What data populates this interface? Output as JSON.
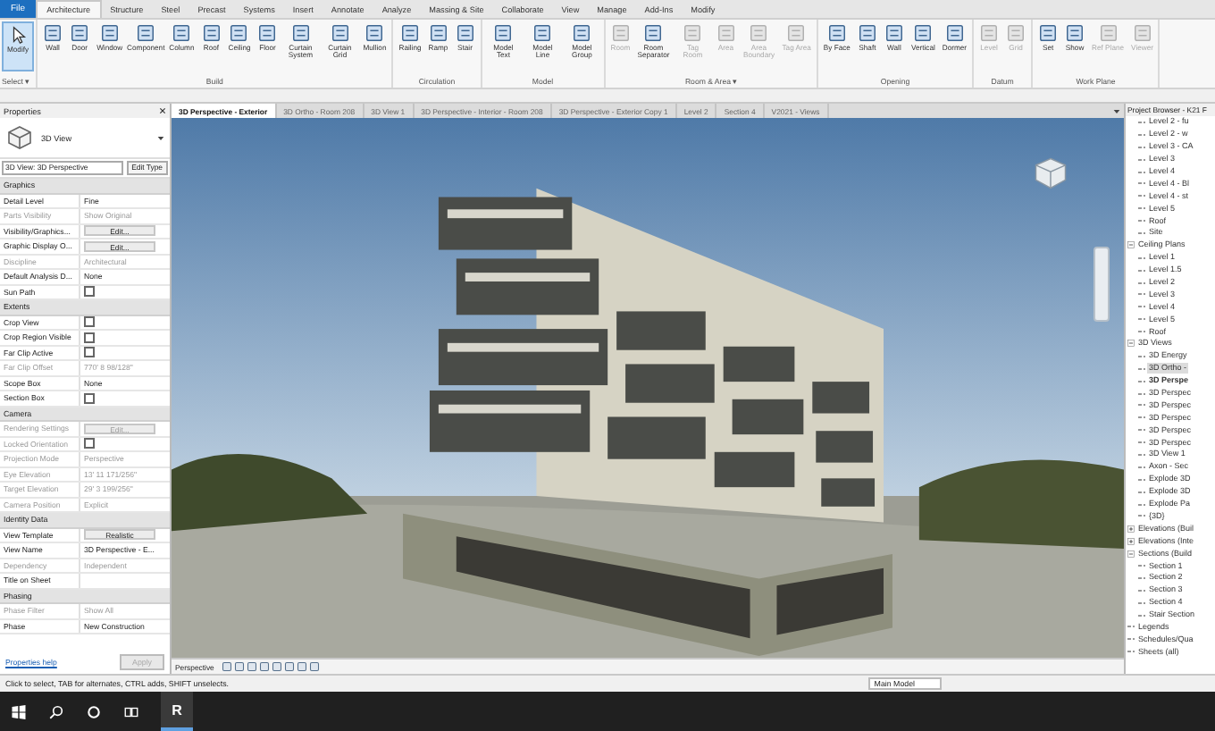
{
  "file_menu": "File",
  "ribbon_tabs": [
    {
      "label": "Architecture",
      "selected": true
    },
    {
      "label": "Structure",
      "selected": false
    },
    {
      "label": "Steel",
      "selected": false
    },
    {
      "label": "Precast",
      "selected": false
    },
    {
      "label": "Systems",
      "selected": false
    },
    {
      "label": "Insert",
      "selected": false
    },
    {
      "label": "Annotate",
      "selected": false
    },
    {
      "label": "Analyze",
      "selected": false
    },
    {
      "label": "Massing & Site",
      "selected": false
    },
    {
      "label": "Collaborate",
      "selected": false
    },
    {
      "label": "View",
      "selected": false
    },
    {
      "label": "Manage",
      "selected": false
    },
    {
      "label": "Add-Ins",
      "selected": false
    },
    {
      "label": "Modify",
      "selected": false
    }
  ],
  "select_panel": {
    "label": "Select ▾",
    "modify": {
      "label": "Modify",
      "selected": true
    }
  },
  "panels": [
    {
      "label": "Build",
      "tools": [
        {
          "label": "Wall",
          "disabled": false
        },
        {
          "label": "Door",
          "disabled": false
        },
        {
          "label": "Window",
          "disabled": false
        },
        {
          "label": "Component",
          "disabled": false
        },
        {
          "label": "Column",
          "disabled": false
        },
        {
          "label": "Roof",
          "disabled": false
        },
        {
          "label": "Ceiling",
          "disabled": false
        },
        {
          "label": "Floor",
          "disabled": false
        },
        {
          "label": "Curtain System",
          "disabled": false
        },
        {
          "label": "Curtain Grid",
          "disabled": false
        },
        {
          "label": "Mullion",
          "disabled": false
        }
      ]
    },
    {
      "label": "Circulation",
      "tools": [
        {
          "label": "Railing",
          "disabled": false
        },
        {
          "label": "Ramp",
          "disabled": false
        },
        {
          "label": "Stair",
          "disabled": false
        }
      ]
    },
    {
      "label": "Model",
      "tools": [
        {
          "label": "Model Text",
          "disabled": false
        },
        {
          "label": "Model Line",
          "disabled": false
        },
        {
          "label": "Model Group",
          "disabled": false
        }
      ]
    },
    {
      "label": "Room & Area ▾",
      "tools": [
        {
          "label": "Room",
          "disabled": true
        },
        {
          "label": "Room Separator",
          "disabled": false
        },
        {
          "label": "Tag Room",
          "disabled": true
        },
        {
          "label": "Area",
          "disabled": true
        },
        {
          "label": "Area Boundary",
          "disabled": true
        },
        {
          "label": "Tag Area",
          "disabled": true
        }
      ]
    },
    {
      "label": "Opening",
      "tools": [
        {
          "label": "By Face",
          "disabled": false
        },
        {
          "label": "Shaft",
          "disabled": false
        },
        {
          "label": "Wall",
          "disabled": false
        },
        {
          "label": "Vertical",
          "disabled": false
        },
        {
          "label": "Dormer",
          "disabled": false
        }
      ]
    },
    {
      "label": "Datum",
      "tools": [
        {
          "label": "Level",
          "disabled": true
        },
        {
          "label": "Grid",
          "disabled": true
        }
      ]
    },
    {
      "label": "Work Plane",
      "tools": [
        {
          "label": "Set",
          "disabled": false
        },
        {
          "label": "Show",
          "disabled": false
        },
        {
          "label": "Ref Plane",
          "disabled": true
        },
        {
          "label": "Viewer",
          "disabled": true
        }
      ]
    }
  ],
  "properties": {
    "title": "Properties",
    "type_name": "3D View",
    "instance": "3D View: 3D Perspective",
    "edit_type": "Edit Type",
    "sections": [
      {
        "label": "Graphics",
        "rows": [
          {
            "label": "Detail Level",
            "kind": "text",
            "value": "Fine",
            "disabled": false
          },
          {
            "label": "Parts Visibility",
            "kind": "text",
            "value": "Show Original",
            "disabled": true
          },
          {
            "label": "Visibility/Graphics...",
            "kind": "button",
            "value": "Edit...",
            "disabled": false
          },
          {
            "label": "Graphic Display O...",
            "kind": "button",
            "value": "Edit...",
            "disabled": false
          },
          {
            "label": "Discipline",
            "kind": "text",
            "value": "Architectural",
            "disabled": true
          },
          {
            "label": "Default Analysis D...",
            "kind": "text",
            "value": "None",
            "disabled": false
          },
          {
            "label": "Sun Path",
            "kind": "checkbox",
            "checked": false,
            "disabled": false
          }
        ]
      },
      {
        "label": "Extents",
        "rows": [
          {
            "label": "Crop View",
            "kind": "checkbox",
            "checked": false,
            "disabled": false
          },
          {
            "label": "Crop Region Visible",
            "kind": "checkbox",
            "checked": false,
            "disabled": false
          },
          {
            "label": "Far Clip Active",
            "kind": "checkbox",
            "checked": false,
            "disabled": false
          },
          {
            "label": "Far Clip Offset",
            "kind": "text",
            "value": "770' 8 98/128\"",
            "disabled": true
          },
          {
            "label": "Scope Box",
            "kind": "text",
            "value": "None",
            "disabled": false
          },
          {
            "label": "Section Box",
            "kind": "checkbox",
            "checked": false,
            "disabled": false
          }
        ]
      },
      {
        "label": "Camera",
        "rows": [
          {
            "label": "Rendering Settings",
            "kind": "button",
            "value": "Edit...",
            "disabled": true
          },
          {
            "label": "Locked Orientation",
            "kind": "checkbox",
            "checked": false,
            "disabled": true
          },
          {
            "label": "Projection Mode",
            "kind": "text",
            "value": "Perspective",
            "disabled": true
          },
          {
            "label": "Eye Elevation",
            "kind": "text",
            "value": "13' 11 171/256\"",
            "disabled": true
          },
          {
            "label": "Target Elevation",
            "kind": "text",
            "value": "29' 3 199/256\"",
            "disabled": true
          },
          {
            "label": "Camera Position",
            "kind": "text",
            "value": "Explicit",
            "disabled": true
          }
        ]
      },
      {
        "label": "Identity Data",
        "rows": [
          {
            "label": "View Template",
            "kind": "button",
            "value": "Realistic",
            "disabled": false
          },
          {
            "label": "View Name",
            "kind": "text",
            "value": "3D Perspective - E...",
            "disabled": false
          },
          {
            "label": "Dependency",
            "kind": "text",
            "value": "Independent",
            "disabled": true
          },
          {
            "label": "Title on Sheet",
            "kind": "text",
            "value": "",
            "disabled": false
          }
        ]
      },
      {
        "label": "Phasing",
        "rows": [
          {
            "label": "Phase Filter",
            "kind": "text",
            "value": "Show All",
            "disabled": true
          },
          {
            "label": "Phase",
            "kind": "text",
            "value": "New Construction",
            "disabled": false
          }
        ]
      }
    ],
    "help_link": "Properties help",
    "apply": {
      "label": "Apply",
      "disabled": true
    }
  },
  "view_tabs": [
    {
      "label": "3D Perspective - Exterior",
      "selected": true
    },
    {
      "label": "3D Ortho - Room 208",
      "selected": false
    },
    {
      "label": "3D View 1",
      "selected": false
    },
    {
      "label": "3D Perspective - Interior - Room 208",
      "selected": false
    },
    {
      "label": "3D Perspective - Exterior Copy 1",
      "selected": false
    },
    {
      "label": "Level 2",
      "selected": false
    },
    {
      "label": "Section 4",
      "selected": false
    },
    {
      "label": "V2021 - Views",
      "selected": false
    }
  ],
  "viewport": {
    "view_mode": "Perspective"
  },
  "project_browser": {
    "title": "Project Browser - K21 F",
    "continued_items": [
      {
        "label": "Level 2 - fu",
        "selected": false
      },
      {
        "label": "Level 2 - w",
        "selected": false
      },
      {
        "label": "Level 3 - CA",
        "selected": false
      },
      {
        "label": "Level 3",
        "selected": false
      },
      {
        "label": "Level 4",
        "selected": false
      },
      {
        "label": "Level 4 - Bl",
        "selected": false
      },
      {
        "label": "Level 4 - st",
        "selected": false
      },
      {
        "label": "Level 5",
        "selected": false
      },
      {
        "label": "Roof",
        "selected": false
      },
      {
        "label": "Site",
        "selected": false
      }
    ],
    "tree": [
      {
        "label": "Ceiling Plans",
        "expanded": true,
        "selected": false,
        "children": [
          {
            "label": "Level 1",
            "selected": false
          },
          {
            "label": "Level 1.5",
            "selected": false
          },
          {
            "label": "Level 2",
            "selected": false
          },
          {
            "label": "Level 3",
            "selected": false
          },
          {
            "label": "Level 4",
            "selected": false
          },
          {
            "label": "Level 5",
            "selected": false
          },
          {
            "label": "Roof",
            "selected": false
          }
        ]
      },
      {
        "label": "3D Views",
        "expanded": true,
        "selected": false,
        "children": [
          {
            "label": "3D Energy",
            "selected": false
          },
          {
            "label": "3D Ortho -",
            "selected": true
          },
          {
            "label": "3D Perspe",
            "selected": false,
            "current": true
          },
          {
            "label": "3D Perspec",
            "selected": false
          },
          {
            "label": "3D Perspec",
            "selected": false
          },
          {
            "label": "3D Perspec",
            "selected": false
          },
          {
            "label": "3D Perspec",
            "selected": false
          },
          {
            "label": "3D Perspec",
            "selected": false
          },
          {
            "label": "3D View 1",
            "selected": false
          },
          {
            "label": "Axon - Sec",
            "selected": false
          },
          {
            "label": "Explode 3D",
            "selected": false
          },
          {
            "label": "Explode 3D",
            "selected": false
          },
          {
            "label": "Explode Pa",
            "selected": false
          },
          {
            "label": "{3D}",
            "selected": false
          }
        ]
      },
      {
        "label": "Elevations (Buil",
        "expanded": false,
        "selected": false
      },
      {
        "label": "Elevations (Inte",
        "expanded": false,
        "selected": false
      },
      {
        "label": "Sections (Build",
        "expanded": true,
        "selected": false,
        "children": [
          {
            "label": "Section 1",
            "selected": false
          },
          {
            "label": "Section 2",
            "selected": false
          },
          {
            "label": "Section 3",
            "selected": false
          },
          {
            "label": "Section 4",
            "selected": false
          },
          {
            "label": "Stair Section",
            "selected": false
          }
        ]
      },
      {
        "label": "Legends",
        "selected": false
      },
      {
        "label": "Schedules/Qua",
        "selected": false
      },
      {
        "label": "Sheets (all)",
        "selected": false
      }
    ]
  },
  "status_bar": {
    "message": "Click to select, TAB for alternates, CTRL adds, SHIFT unselects.",
    "model": "Main Model"
  },
  "taskbar": {
    "app_label": "R"
  }
}
